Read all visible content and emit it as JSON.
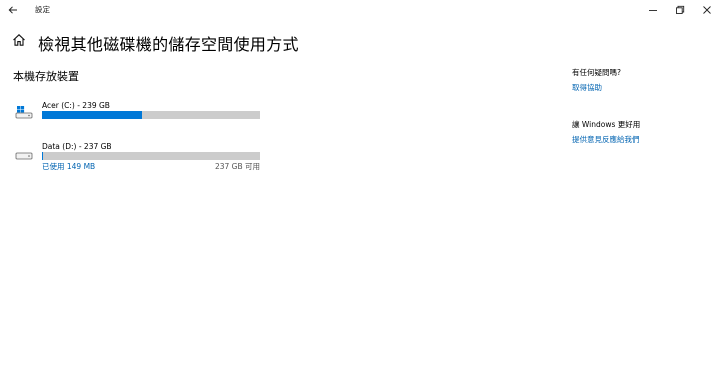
{
  "window": {
    "title": "設定",
    "back_icon": "back-arrow-icon",
    "controls": [
      "minimize-icon",
      "maximize-icon",
      "close-icon"
    ]
  },
  "page": {
    "title": "檢視其他磁碟機的儲存空間使用方式",
    "section_title": "本機存放裝置"
  },
  "drives": [
    {
      "name": "Acer (C:) - 239 GB",
      "icon": "windows-drive-icon",
      "used_fraction": 0.46,
      "used_label": "",
      "free_label": ""
    },
    {
      "name": "Data (D:) - 237 GB",
      "icon": "hard-drive-icon",
      "used_fraction": 0.001,
      "used_label": "已使用 149 MB",
      "free_label": "237 GB 可用"
    }
  ],
  "sidebar": {
    "help_heading": "有任何疑問嗎?",
    "help_link": "取得協助",
    "feedback_heading": "讓 Windows 更好用",
    "feedback_link": "提供意見反應給我們"
  },
  "colors": {
    "accent": "#0078d7",
    "link": "#0063b1",
    "bar_track": "#cccccc"
  }
}
